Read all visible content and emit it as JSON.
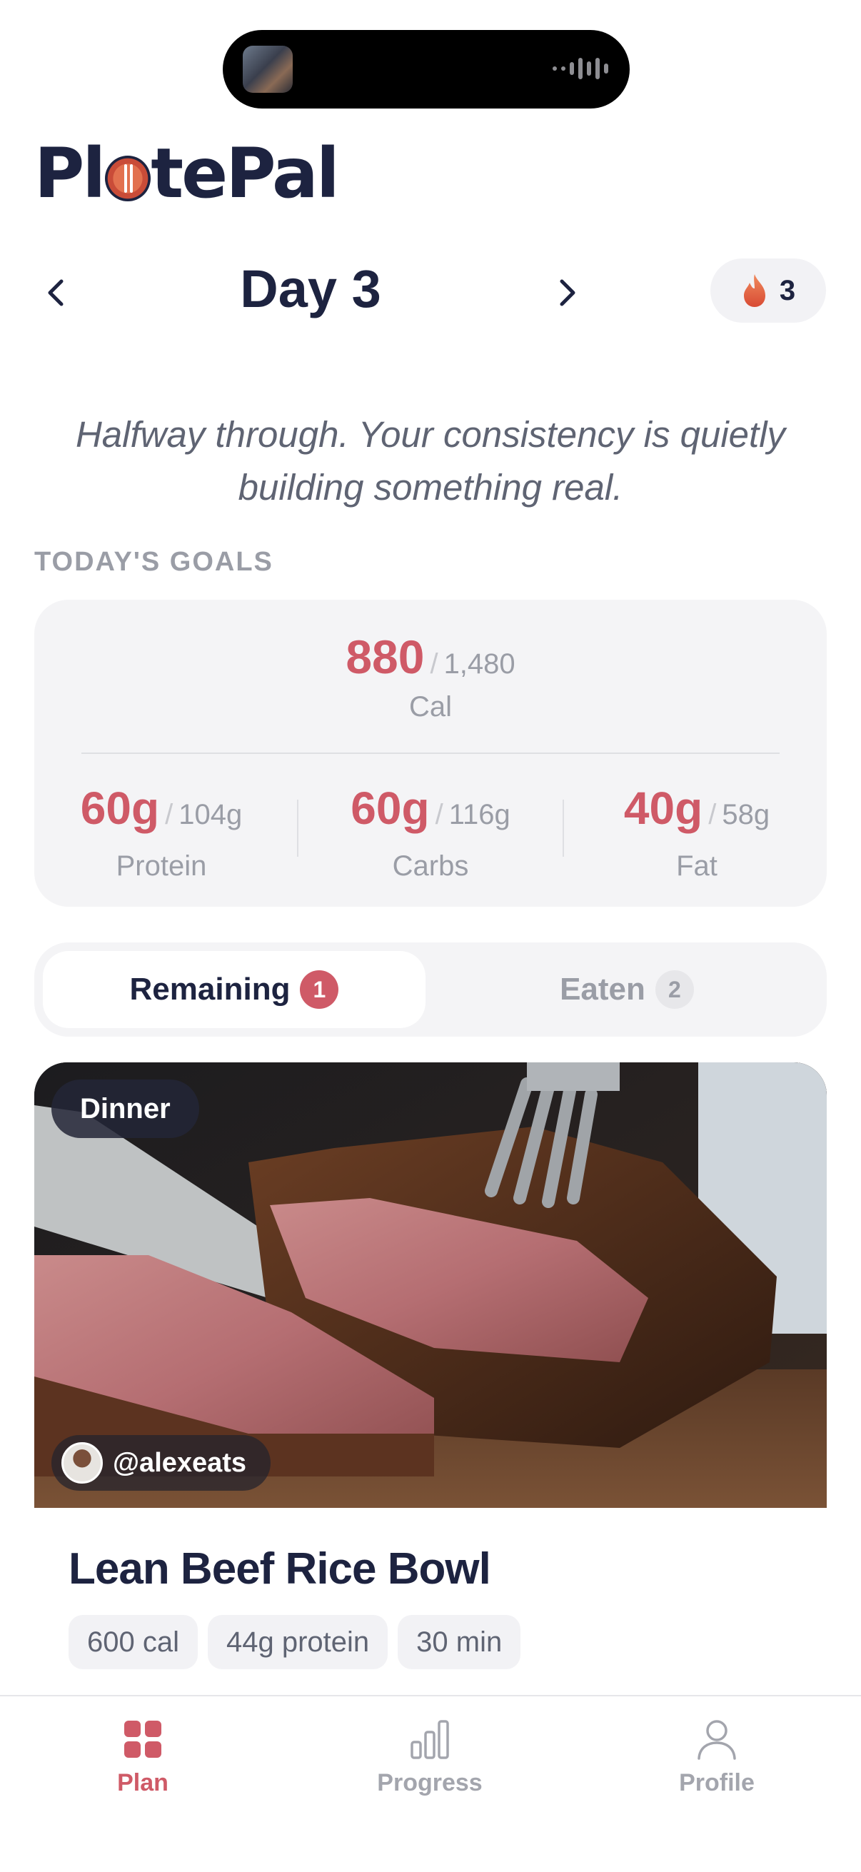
{
  "app": {
    "name_left": "Pl",
    "name_right": "tePal"
  },
  "header": {
    "title": "Day 3",
    "streak_count": "3"
  },
  "quote": "Halfway through. Your consistency is quietly building something real.",
  "goals": {
    "section_label": "TODAY'S GOALS",
    "calories": {
      "eaten": "880",
      "target": "1,480",
      "label": "Cal"
    },
    "macros": [
      {
        "label": "Protein",
        "eaten": "60g",
        "target": "104g"
      },
      {
        "label": "Carbs",
        "eaten": "60g",
        "target": "116g"
      },
      {
        "label": "Fat",
        "eaten": "40g",
        "target": "58g"
      }
    ]
  },
  "tabs_segment": {
    "remaining": {
      "label": "Remaining",
      "count": "1"
    },
    "eaten": {
      "label": "Eaten",
      "count": "2"
    }
  },
  "meal": {
    "type": "Dinner",
    "author": "@alexeats",
    "title": "Lean Beef Rice Bowl",
    "chips": [
      "600 cal",
      "44g protein",
      "30 min"
    ]
  },
  "tabbar": {
    "items": [
      {
        "label": "Plan",
        "icon": "grid-icon"
      },
      {
        "label": "Progress",
        "icon": "bar-chart-icon"
      },
      {
        "label": "Profile",
        "icon": "person-icon"
      }
    ]
  },
  "colors": {
    "accent": "#cf5a67",
    "navy": "#1d2340",
    "muted": "#9a9da6",
    "card": "#f4f4f6"
  }
}
